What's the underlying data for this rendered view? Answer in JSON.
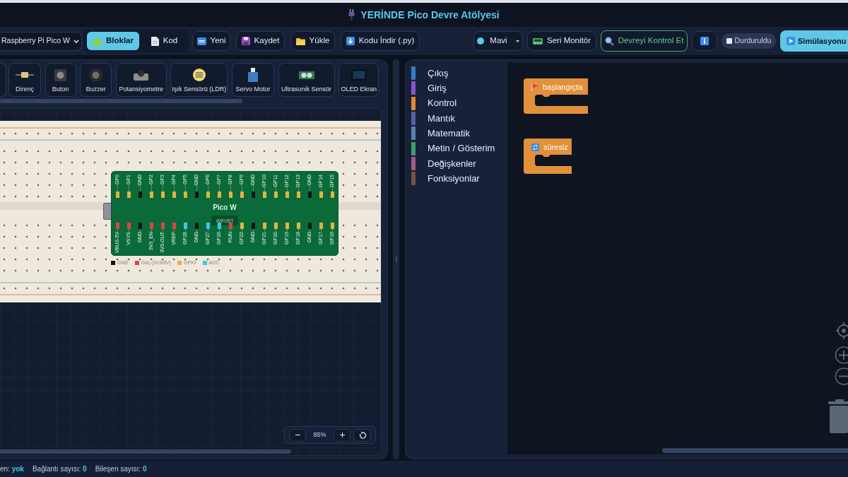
{
  "title_bar": {
    "title": "YERİNDE Pico Devre Atölyesi"
  },
  "toolbar": {
    "board_select": {
      "value": "Raspberry Pi Pico W"
    },
    "view_tabs": [
      {
        "label": "Bloklar",
        "kind": "blocks",
        "selected": true
      },
      {
        "label": "Kod",
        "kind": "code",
        "selected": false
      }
    ],
    "file_buttons": [
      {
        "label": "Yeni",
        "kind": "new"
      },
      {
        "label": "Kaydet",
        "kind": "save"
      },
      {
        "label": "Yükle",
        "kind": "open"
      },
      {
        "label": "Kodu İndir (.py)",
        "kind": "download"
      }
    ],
    "theme_select": {
      "value": "Mavi",
      "color": "#5bc8ee"
    },
    "serial_button": {
      "label": "Seri Monitör"
    },
    "check_button": {
      "label": "Devreyi Kontrol Et"
    },
    "status_badge": {
      "label": "Durduruldu"
    },
    "simulate_button": {
      "label": "Simülasyonu"
    }
  },
  "palette": {
    "items": [
      {
        "label": "Direnç",
        "kind": "resistor"
      },
      {
        "label": "Buton",
        "kind": "button"
      },
      {
        "label": "Buzzer",
        "kind": "buzzer"
      },
      {
        "label": "Potansiyometre",
        "kind": "potentiometer"
      },
      {
        "label": "Işık Sensörü (LDR)",
        "kind": "ldr"
      },
      {
        "label": "Servo Motor",
        "kind": "servo"
      },
      {
        "label": "Ultrasonik Sensör",
        "kind": "ultrasonic"
      },
      {
        "label": "OLED Ekran",
        "kind": "oled"
      }
    ]
  },
  "circuit": {
    "board": {
      "name": "Pico W",
      "chip": "WiFi/BT",
      "top_pins": [
        {
          "label": "GP0",
          "color": "#e2b43c"
        },
        {
          "label": "GP1",
          "color": "#e2b43c"
        },
        {
          "label": "GND",
          "color": "#141414"
        },
        {
          "label": "GP2",
          "color": "#e2b43c"
        },
        {
          "label": "GP3",
          "color": "#e2b43c"
        },
        {
          "label": "GP4",
          "color": "#e2b43c"
        },
        {
          "label": "GP5",
          "color": "#e2b43c"
        },
        {
          "label": "GND",
          "color": "#141414"
        },
        {
          "label": "GP6",
          "color": "#e2b43c"
        },
        {
          "label": "GP7",
          "color": "#e2b43c"
        },
        {
          "label": "GP8",
          "color": "#e2b43c"
        },
        {
          "label": "GP9",
          "color": "#e2b43c"
        },
        {
          "label": "GND",
          "color": "#141414"
        },
        {
          "label": "GP10",
          "color": "#e2b43c"
        },
        {
          "label": "GP11",
          "color": "#e2b43c"
        },
        {
          "label": "GP12",
          "color": "#e2b43c"
        },
        {
          "label": "GP13",
          "color": "#e2b43c"
        },
        {
          "label": "GND",
          "color": "#141414"
        },
        {
          "label": "GP14",
          "color": "#e2b43c"
        },
        {
          "label": "GP15",
          "color": "#e2b43c"
        }
      ],
      "bottom_pins": [
        {
          "label": "VBUS-5V",
          "color": "#e04343"
        },
        {
          "label": "VSYS",
          "color": "#e04343"
        },
        {
          "label": "GND",
          "color": "#141414"
        },
        {
          "label": "3V3_EN",
          "color": "#e04343"
        },
        {
          "label": "3V3-OUT",
          "color": "#e04343"
        },
        {
          "label": "VREF",
          "color": "#e04343"
        },
        {
          "label": "GP28",
          "color": "#3ec7ea"
        },
        {
          "label": "GND",
          "color": "#141414"
        },
        {
          "label": "GP27",
          "color": "#3ec7ea"
        },
        {
          "label": "GP26",
          "color": "#3ec7ea"
        },
        {
          "label": "RUN",
          "color": "#e04343"
        },
        {
          "label": "GP22",
          "color": "#e2b43c"
        },
        {
          "label": "GND",
          "color": "#141414"
        },
        {
          "label": "GP21",
          "color": "#e2b43c"
        },
        {
          "label": "GP20",
          "color": "#e2b43c"
        },
        {
          "label": "GP19",
          "color": "#e2b43c"
        },
        {
          "label": "GP18",
          "color": "#e2b43c"
        },
        {
          "label": "GND",
          "color": "#141414"
        },
        {
          "label": "GP17",
          "color": "#e2b43c"
        },
        {
          "label": "GP16",
          "color": "#e2b43c"
        }
      ]
    },
    "legend": [
      {
        "label": "GND",
        "color": "#141414"
      },
      {
        "label": "Güç (3V3/5V)",
        "color": "#e04343"
      },
      {
        "label": "GPIO",
        "color": "#e2b43c"
      },
      {
        "label": "ADC",
        "color": "#3ec7ea"
      }
    ],
    "zoom": {
      "value": "85%"
    }
  },
  "blocks": {
    "categories": [
      {
        "label": "Çıkış",
        "color": "#3b7bbf"
      },
      {
        "label": "Giriş",
        "color": "#8b52c9"
      },
      {
        "label": "Kontrol",
        "color": "#e08a30"
      },
      {
        "label": "Mantık",
        "color": "#5b5ea6"
      },
      {
        "label": "Matematik",
        "color": "#5b80a5"
      },
      {
        "label": "Metin / Gösterim",
        "color": "#3ea06a"
      },
      {
        "label": "Değişkenler",
        "color": "#a55b80"
      },
      {
        "label": "Fonksiyonlar",
        "color": "#7a5040"
      }
    ],
    "workspace_blocks": [
      {
        "label": "başlangıçta",
        "kind": "start"
      },
      {
        "label": "süresiz",
        "kind": "forever"
      }
    ]
  },
  "status_bar": {
    "items": [
      {
        "label": "en:",
        "value": "yok"
      },
      {
        "label": "Bağlantı sayısı:",
        "value": "0"
      },
      {
        "label": "Bileşen sayısı:",
        "value": "0"
      }
    ]
  }
}
